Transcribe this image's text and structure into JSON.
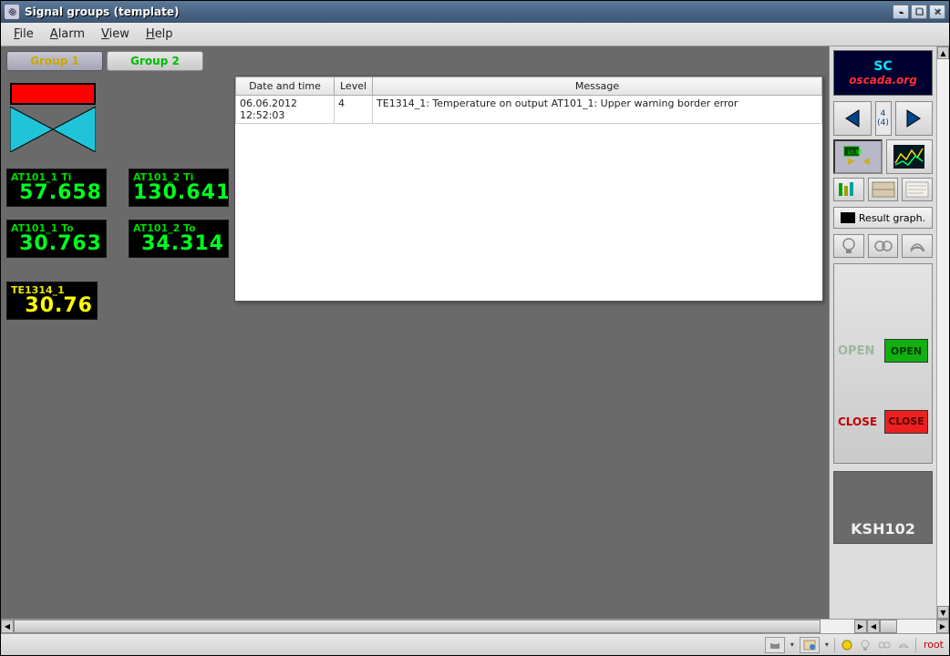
{
  "window": {
    "title": "Signal groups (template)"
  },
  "menu": {
    "file": "File",
    "alarm": "Alarm",
    "view": "View",
    "help": "Help"
  },
  "tabs": {
    "active": 0,
    "items": [
      {
        "label": "Group 1"
      },
      {
        "label": "Group 2"
      }
    ]
  },
  "signals": {
    "ti1": {
      "label": "AT101_1 Ti",
      "value": "57.658"
    },
    "ti2": {
      "label": "AT101_2 Ti",
      "value": "130.641"
    },
    "to1": {
      "label": "AT101_1 To",
      "value": "30.763"
    },
    "to2": {
      "label": "AT101_2 To",
      "value": "34.314"
    },
    "te": {
      "label": "TE1314_1",
      "value": "30.76"
    }
  },
  "msg_table": {
    "headers": {
      "dt": "Date and time",
      "lvl": "Level",
      "msg": "Message"
    },
    "rows": [
      {
        "dt": "06.06.2012 12:52:03",
        "lvl": "4",
        "msg": "TE1314_1: Temperature on output  AT101_1: Upper warning border error"
      }
    ]
  },
  "logo": {
    "top": "SC",
    "url": "oscada.org"
  },
  "nav": {
    "count": "4",
    "count_paren": "(4)"
  },
  "sidebar": {
    "result_graph": "Result graph.",
    "open_label": "OPEN",
    "open_btn": "OPEN",
    "close_label": "CLOSE",
    "close_btn": "CLOSE",
    "device": "KSH102"
  },
  "statusbar": {
    "user": "root"
  }
}
